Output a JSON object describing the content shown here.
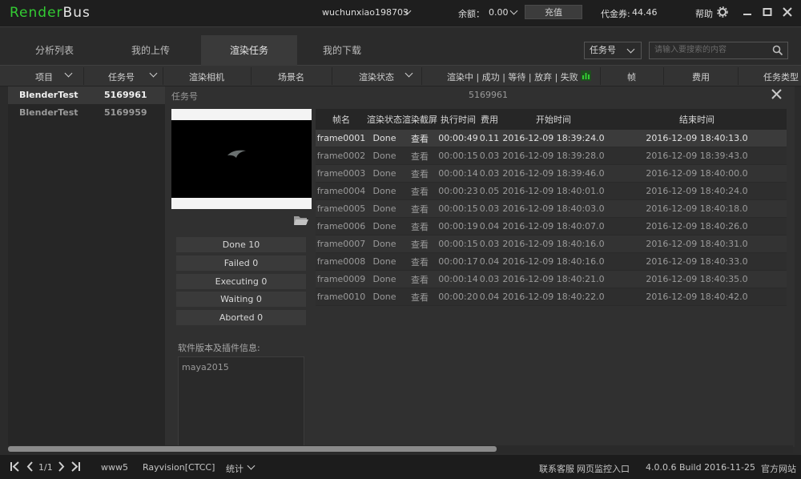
{
  "app": {
    "logo_part1": "Render",
    "logo_part2": "Bus"
  },
  "titlebar": {
    "username": "wuchunxiao198703",
    "balance_label": "余额：",
    "balance_value": "0.00",
    "recharge": "充值",
    "voucher_label": "代金券:",
    "voucher_value": "44.46",
    "help": "帮助"
  },
  "tabs": [
    "分析列表",
    "我的上传",
    "渲染任务",
    "我的下载"
  ],
  "filter": {
    "select_value": "任务号",
    "search_placeholder": "请输入要搜索的内容"
  },
  "columns": {
    "project": "项目",
    "task_no": "任务号",
    "camera": "渲染相机",
    "scene": "场景名",
    "status": "渲染状态",
    "progress": "渲染中 | 成功 | 等待 | 放弃 | 失败",
    "frames": "帧",
    "cost": "费用",
    "type": "任务类型"
  },
  "tasks": [
    {
      "project": "BlenderTest",
      "task_no": "5169961"
    },
    {
      "project": "BlenderTest",
      "task_no": "5169959"
    }
  ],
  "detail": {
    "task_label": "任务号",
    "task_no": "5169961",
    "stats": {
      "done": "Done  10",
      "failed": "Failed  0",
      "executing": "Executing  0",
      "waiting": "Waiting  0",
      "aborted": "Aborted  0"
    },
    "software_label": "软件版本及插件信息:",
    "software_value": "maya2015"
  },
  "frames_table": {
    "headers": [
      "帧名",
      "渲染状态",
      "渲染截屏",
      "执行时间",
      "费用",
      "开始时间",
      "结束时间"
    ],
    "rows": [
      [
        "frame0001",
        "Done",
        "查看",
        "00:00:49",
        "0.11",
        "2016-12-09 18:39:24.0",
        "2016-12-09 18:40:13.0"
      ],
      [
        "frame0002",
        "Done",
        "查看",
        "00:00:15",
        "0.03",
        "2016-12-09 18:39:28.0",
        "2016-12-09 18:39:43.0"
      ],
      [
        "frame0003",
        "Done",
        "查看",
        "00:00:14",
        "0.03",
        "2016-12-09 18:39:46.0",
        "2016-12-09 18:40:00.0"
      ],
      [
        "frame0004",
        "Done",
        "查看",
        "00:00:23",
        "0.05",
        "2016-12-09 18:40:01.0",
        "2016-12-09 18:40:24.0"
      ],
      [
        "frame0005",
        "Done",
        "查看",
        "00:00:15",
        "0.03",
        "2016-12-09 18:40:03.0",
        "2016-12-09 18:40:18.0"
      ],
      [
        "frame0006",
        "Done",
        "查看",
        "00:00:19",
        "0.04",
        "2016-12-09 18:40:07.0",
        "2016-12-09 18:40:26.0"
      ],
      [
        "frame0007",
        "Done",
        "查看",
        "00:00:15",
        "0.03",
        "2016-12-09 18:40:16.0",
        "2016-12-09 18:40:31.0"
      ],
      [
        "frame0008",
        "Done",
        "查看",
        "00:00:17",
        "0.04",
        "2016-12-09 18:40:16.0",
        "2016-12-09 18:40:33.0"
      ],
      [
        "frame0009",
        "Done",
        "查看",
        "00:00:14",
        "0.03",
        "2016-12-09 18:40:21.0",
        "2016-12-09 18:40:35.0"
      ],
      [
        "frame0010",
        "Done",
        "查看",
        "00:00:20",
        "0.04",
        "2016-12-09 18:40:22.0",
        "2016-12-09 18:40:42.0"
      ]
    ]
  },
  "statusbar": {
    "page": "1/1",
    "user": "www5",
    "server": "Rayvision[CTCC]",
    "stats": "统计",
    "support": "联系客服",
    "monitor": "网页监控入口",
    "version": "4.0.0.6 Build 2016-11-25",
    "website": "官方网站"
  },
  "colors": {
    "brand_green": "#33cc33",
    "background": "#2b2b2b"
  }
}
